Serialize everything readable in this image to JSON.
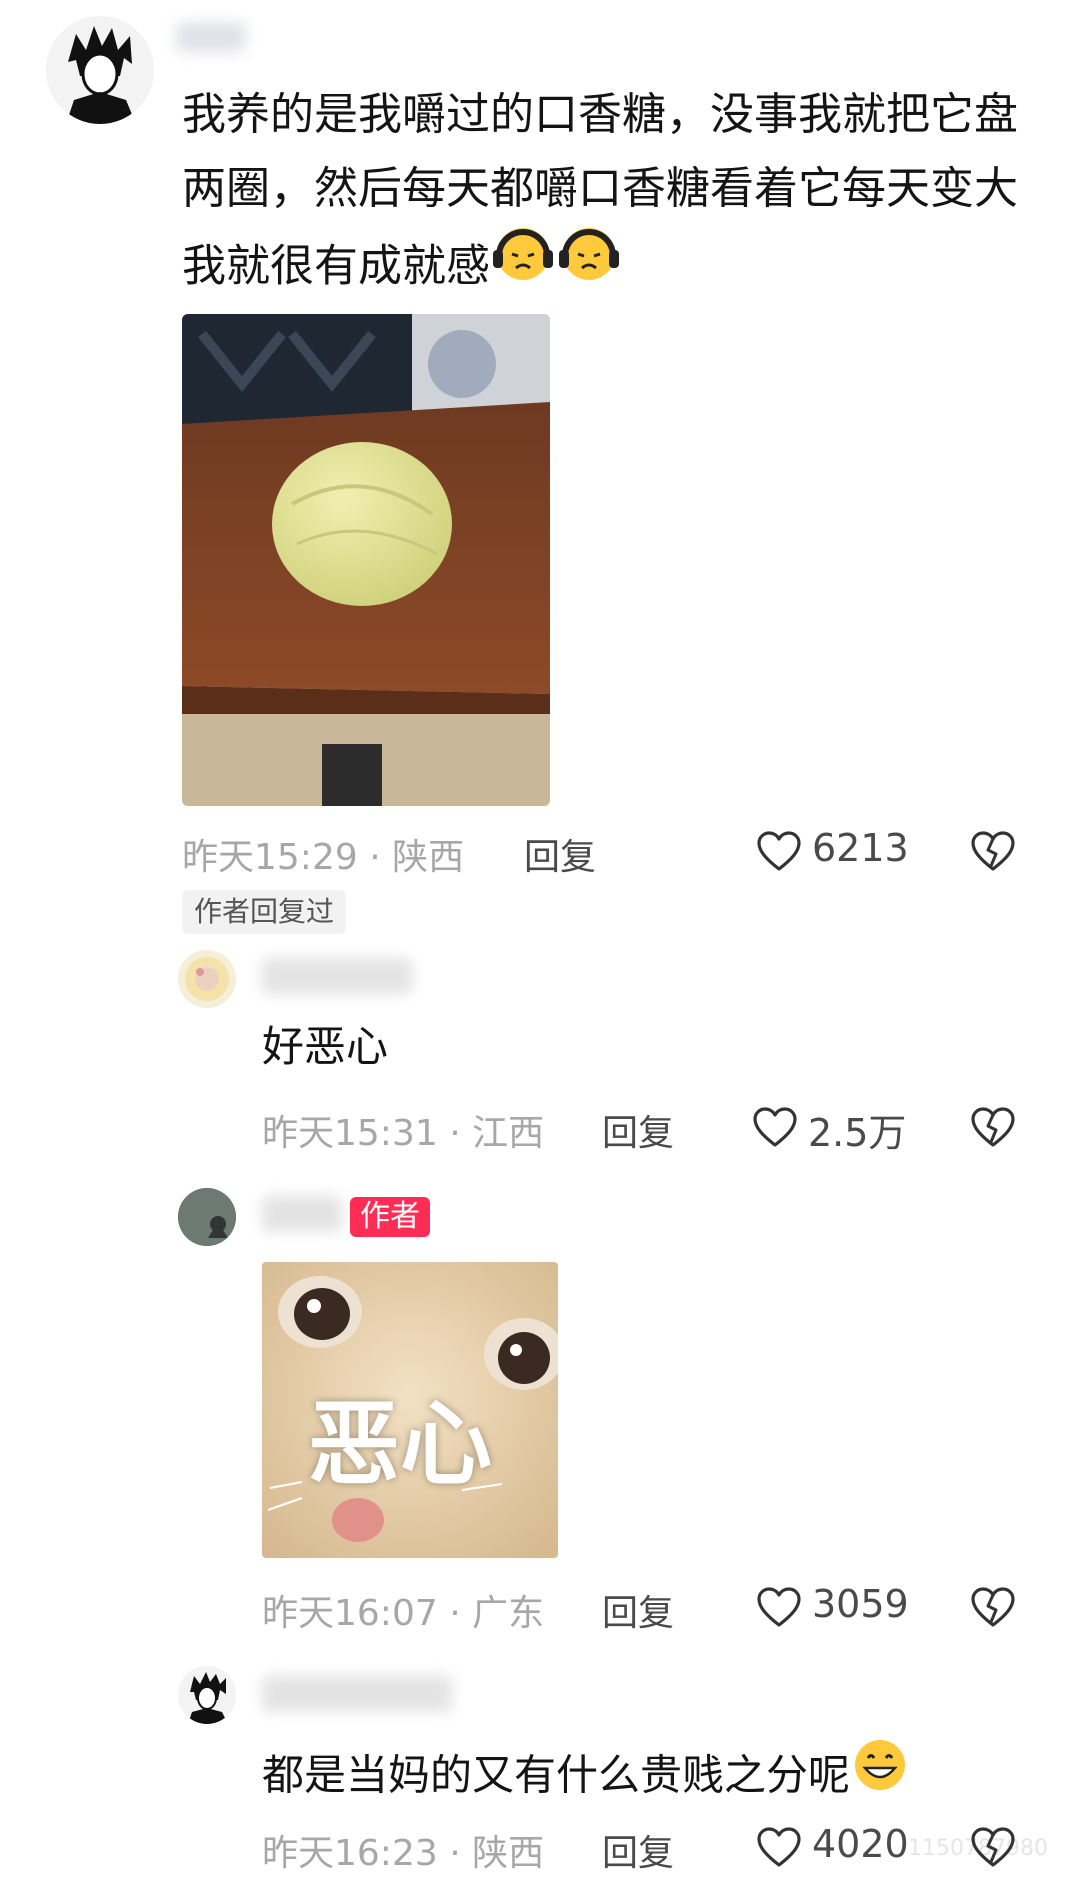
{
  "comment": {
    "text": "我养的是我嚼过的口香糖，没事我就把它盘两圈，然后每天都嚼口香糖看着它每天变大我就很有成就感",
    "time": "昨天15:29 · 陕西",
    "reply_label": "回复",
    "likes": "6213",
    "author_replied_tag": "作者回复过"
  },
  "replies": [
    {
      "text": "好恶心",
      "time": "昨天15:31 · 江西",
      "reply_label": "回复",
      "likes": "2.5万"
    },
    {
      "badge": "作者",
      "sticker_text": "恶心",
      "time": "昨天16:07 · 广东",
      "reply_label": "回复",
      "likes": "3059"
    },
    {
      "text": "都是当妈的又有什么贵贱之分呢",
      "time": "昨天16:23 · 陕西",
      "reply_label": "回复",
      "likes": "4020"
    }
  ],
  "watermark": "1150787980",
  "icons": [
    "heart-outline-icon",
    "broken-heart-icon",
    "sad-face-emoji",
    "grinning-face-emoji"
  ],
  "colors": {
    "author_badge": "#ff2c55",
    "meta_text": "#a7a7a7"
  }
}
